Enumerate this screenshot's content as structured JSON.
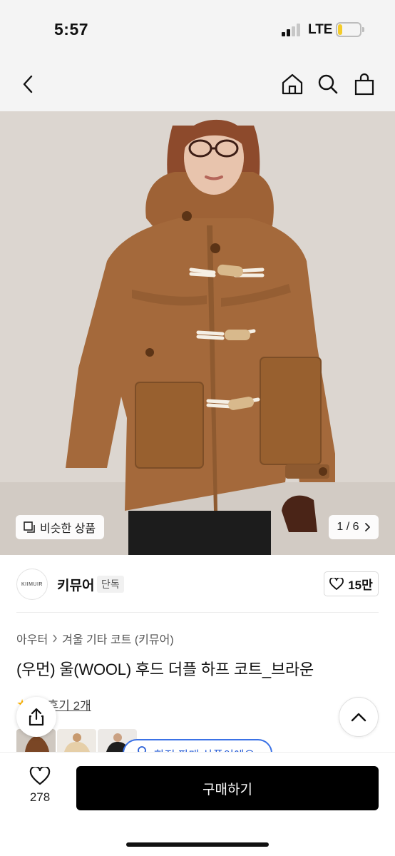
{
  "status_bar": {
    "time": "5:57",
    "network": "LTE",
    "battery_level": 0.2,
    "signal_bars": 2
  },
  "header": {
    "back_icon": "chevron-left-icon",
    "home_icon": "home-icon",
    "search_icon": "search-icon",
    "cart_icon": "shopping-bag-icon"
  },
  "gallery": {
    "similar_label": "비슷한 상품",
    "page_indicator": "1 / 6"
  },
  "brand": {
    "logo_text": "KIIMUIR",
    "name": "키뮤어",
    "badge": "단독",
    "likes": "15만"
  },
  "product": {
    "breadcrumb": [
      "아우터",
      "겨울 기타 코트 (키뮤어)"
    ],
    "title": "(우먼) 울(WOOL) 후드 더플 하프 코트_브라운",
    "rating": "5",
    "review_link": "후기 2개",
    "limited_label": "한정 판매 상품이에요"
  },
  "bottom_bar": {
    "wish_count": "278",
    "buy_label": "구매하기"
  },
  "colors": {
    "accent_blue": "#3b72e6",
    "buy_button": "#000000",
    "coat": "#a4693b",
    "star": "#ffb400"
  }
}
